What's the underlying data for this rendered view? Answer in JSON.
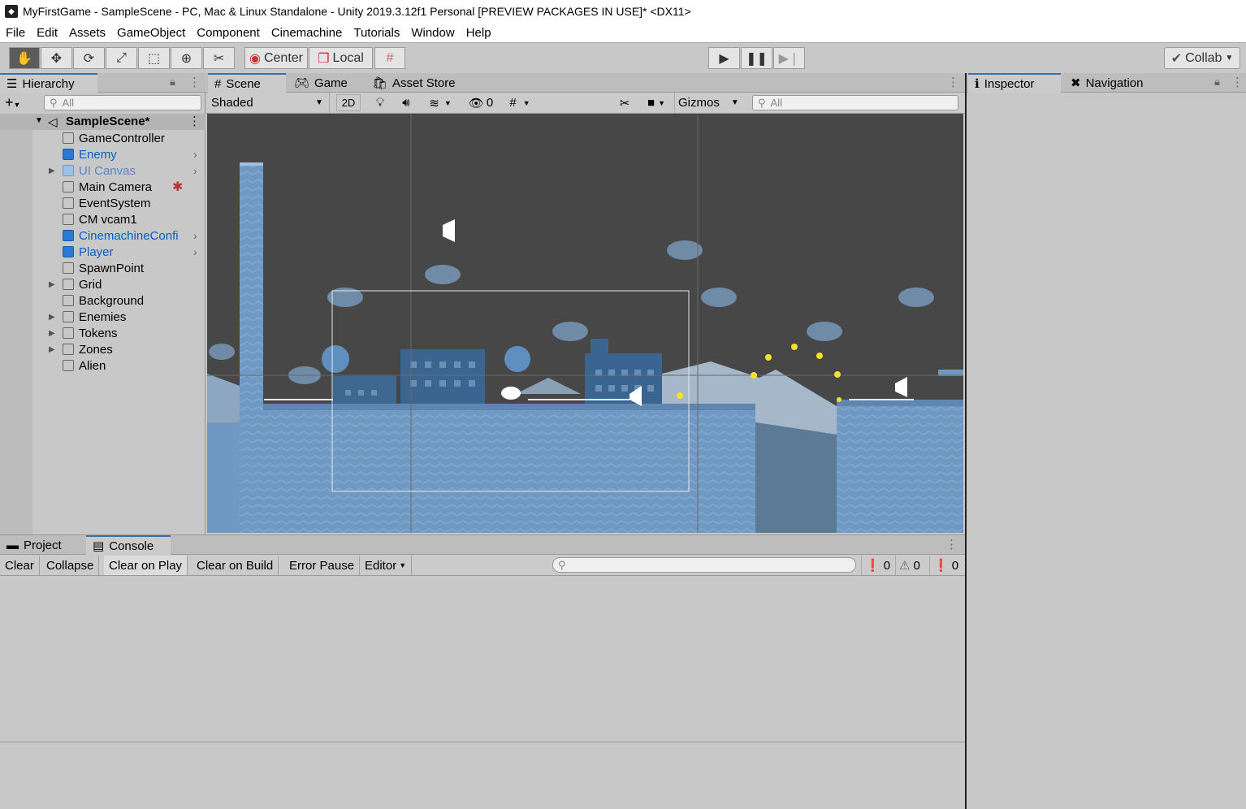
{
  "window": {
    "title": "MyFirstGame - SampleScene - PC, Mac & Linux Standalone - Unity 2019.3.12f1 Personal [PREVIEW PACKAGES IN USE]* <DX11>"
  },
  "menu": [
    "File",
    "Edit",
    "Assets",
    "GameObject",
    "Component",
    "Cinemachine",
    "Tutorials",
    "Window",
    "Help"
  ],
  "toolbar": {
    "tools": [
      "hand-icon",
      "move-icon",
      "rotate-icon",
      "scale-icon",
      "rect-icon",
      "transform-icon",
      "custom-tool-icon"
    ],
    "pivot": "Center",
    "space": "Local",
    "collab": "Collab"
  },
  "hierarchy": {
    "tab": "Hierarchy",
    "search_placeholder": "All",
    "scene": "SampleScene*",
    "items": [
      {
        "name": "GameController",
        "style": "normal",
        "arrow": false,
        "chev": false
      },
      {
        "name": "Enemy",
        "style": "blue",
        "arrow": false,
        "chev": true
      },
      {
        "name": "UI Canvas",
        "style": "lblue",
        "arrow": true,
        "chev": true
      },
      {
        "name": "Main Camera",
        "style": "normal",
        "arrow": false,
        "chev": false
      },
      {
        "name": "EventSystem",
        "style": "normal",
        "arrow": false,
        "chev": false
      },
      {
        "name": "CM vcam1",
        "style": "normal",
        "arrow": false,
        "chev": false
      },
      {
        "name": "CinemachineConfi",
        "style": "blue",
        "arrow": false,
        "chev": true
      },
      {
        "name": "Player",
        "style": "blue",
        "arrow": false,
        "chev": true
      },
      {
        "name": "SpawnPoint",
        "style": "normal",
        "arrow": false,
        "chev": false
      },
      {
        "name": "Grid",
        "style": "normal",
        "arrow": true,
        "chev": false
      },
      {
        "name": "Background",
        "style": "normal",
        "arrow": false,
        "chev": false
      },
      {
        "name": "Enemies",
        "style": "normal",
        "arrow": true,
        "chev": false
      },
      {
        "name": "Tokens",
        "style": "normal",
        "arrow": true,
        "chev": false
      },
      {
        "name": "Zones",
        "style": "normal",
        "arrow": true,
        "chev": false
      },
      {
        "name": "Alien",
        "style": "normal",
        "arrow": false,
        "chev": false
      }
    ]
  },
  "scene": {
    "tabs": [
      "Scene",
      "Game",
      "Asset Store"
    ],
    "shading": "Shaded",
    "mode_2d": "2D",
    "hidden_count": "0",
    "gizmos": "Gizmos",
    "search_placeholder": "All"
  },
  "console": {
    "tabs": [
      "Project",
      "Console"
    ],
    "buttons": [
      "Clear",
      "Collapse",
      "Clear on Play",
      "Clear on Build",
      "Error Pause",
      "Editor"
    ],
    "counts": {
      "errors": "0",
      "warnings": "0",
      "messages": "0"
    }
  },
  "inspector": {
    "tabs": [
      "Inspector",
      "Navigation"
    ]
  },
  "colors": {
    "accent": "#3a72b0",
    "sky": "#474747",
    "ground": "#6e97c0",
    "prefab_blue": "#0d5cc4"
  }
}
